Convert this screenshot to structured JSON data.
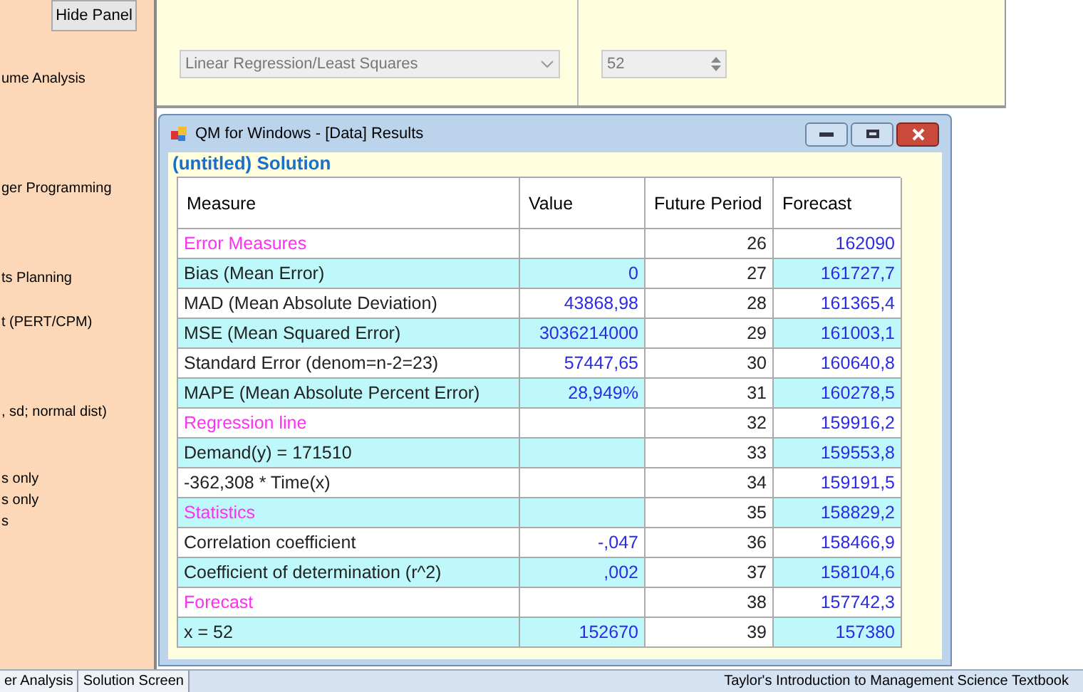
{
  "side_panel": {
    "button": "Hide Panel",
    "items": [
      "ume Analysis",
      "ger Programming",
      "ts Planning",
      "t (PERT/CPM)",
      ", sd; normal dist)",
      "s only",
      "s only",
      "s"
    ]
  },
  "options": {
    "method": "Linear Regression/Least Squares",
    "period": "52"
  },
  "window": {
    "title": "QM for Windows - [Data] Results",
    "subtitle": "(untitled) Solution"
  },
  "table": {
    "columns": [
      "Measure",
      "Value",
      "Future Period",
      "Forecast"
    ],
    "rows": [
      {
        "kind": "heading",
        "measure": "Error Measures",
        "value": "",
        "period": "26",
        "forecast": "162090"
      },
      {
        "kind": "item",
        "measure": "Bias (Mean Error)",
        "value": "0",
        "period": "27",
        "forecast": "161727,7"
      },
      {
        "kind": "item",
        "measure": "MAD (Mean Absolute Deviation)",
        "value": "43868,98",
        "period": "28",
        "forecast": "161365,4"
      },
      {
        "kind": "item",
        "measure": "MSE (Mean Squared Error)",
        "value": "3036214000",
        "period": "29",
        "forecast": "161003,1"
      },
      {
        "kind": "item",
        "measure": "Standard Error (denom=n-2=23)",
        "value": "57447,65",
        "period": "30",
        "forecast": "160640,8"
      },
      {
        "kind": "item",
        "measure": "MAPE (Mean Absolute Percent Error)",
        "value": "28,949%",
        "period": "31",
        "forecast": "160278,5"
      },
      {
        "kind": "heading",
        "measure": "Regression line",
        "value": "",
        "period": "32",
        "forecast": "159916,2"
      },
      {
        "kind": "item",
        "measure": "Demand(y) = 171510",
        "value": "",
        "period": "33",
        "forecast": "159553,8"
      },
      {
        "kind": "item",
        "measure": "-362,308 * Time(x)",
        "value": "",
        "period": "34",
        "forecast": "159191,5"
      },
      {
        "kind": "heading",
        "measure": "Statistics",
        "value": "",
        "period": "35",
        "forecast": "158829,2"
      },
      {
        "kind": "item",
        "measure": "Correlation coefficient",
        "value": "-,047",
        "period": "36",
        "forecast": "158466,9"
      },
      {
        "kind": "item",
        "measure": "Coefficient of determination (r^2)",
        "value": ",002",
        "period": "37",
        "forecast": "158104,6"
      },
      {
        "kind": "heading",
        "measure": "Forecast",
        "value": "",
        "period": "38",
        "forecast": "157742,3"
      },
      {
        "kind": "item",
        "measure": "x = 52",
        "value": "152670",
        "period": "39",
        "forecast": "157380"
      }
    ]
  },
  "bottom_tabs": [
    "er Analysis",
    "Solution Screen"
  ],
  "status_bar": "Taylor's Introduction to Management Science Textbook"
}
